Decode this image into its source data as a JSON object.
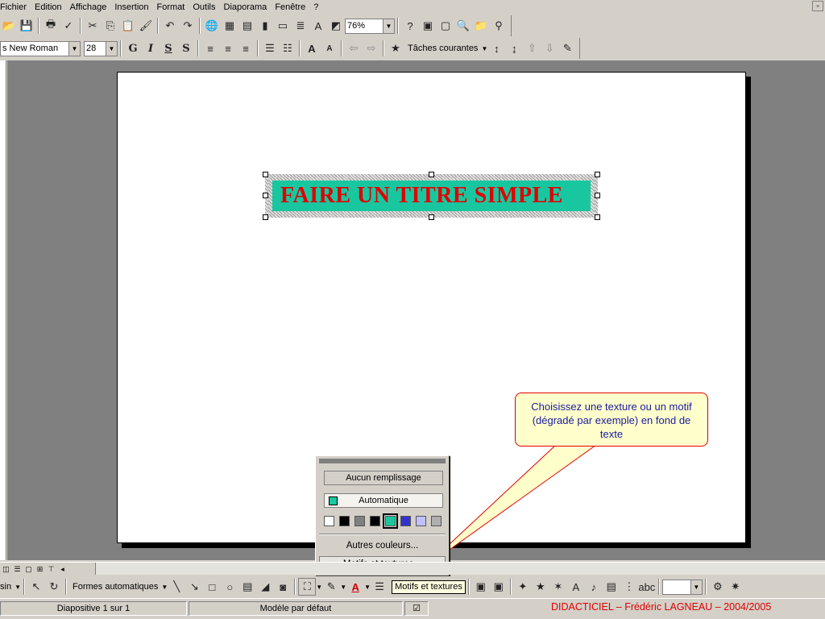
{
  "menubar": {
    "items": [
      "Fichier",
      "Edition",
      "Affichage",
      "Insertion",
      "Format",
      "Outils",
      "Diaporama",
      "Fenêtre",
      "?"
    ]
  },
  "toolbar_standard": {
    "zoom": "76%"
  },
  "toolbar_format": {
    "font_name": "s New Roman",
    "font_size": "28",
    "bold_label": "G",
    "italic_label": "I",
    "underline_label": "S",
    "shadow_label": "S",
    "tasks_label": "Tâches courantes"
  },
  "slide": {
    "title": "FAIRE UN TITRE SIMPLE",
    "title_color": "#e00000",
    "fill_color": "#18c7a0"
  },
  "callout": {
    "text": "Choisissez une texture ou un motif (dégradé par exemple) en fond de texte",
    "border_color": "#e00000",
    "bg_color": "#ffffcc"
  },
  "fill_popup": {
    "no_fill": "Aucun remplissage",
    "automatic": "Automatique",
    "swatches": [
      "#ffffff",
      "#000000",
      "#808080",
      "#000000",
      "#18c7a0",
      "#3333cc",
      "#c0c0ff",
      "#b0b0b0"
    ],
    "more_colors": "Autres couleurs...",
    "patterns": "Motifs et textures..."
  },
  "drawing_toolbar": {
    "draw_label": "sin",
    "autoshapes_label": "Formes automatiques",
    "tooltip": "Motifs et textures"
  },
  "status": {
    "slide_info": "Diapositive 1 sur 1",
    "template": "Modèle par défaut",
    "credit": "DIDACTICIEL – Frédéric LAGNEAU – 2004/2005"
  }
}
